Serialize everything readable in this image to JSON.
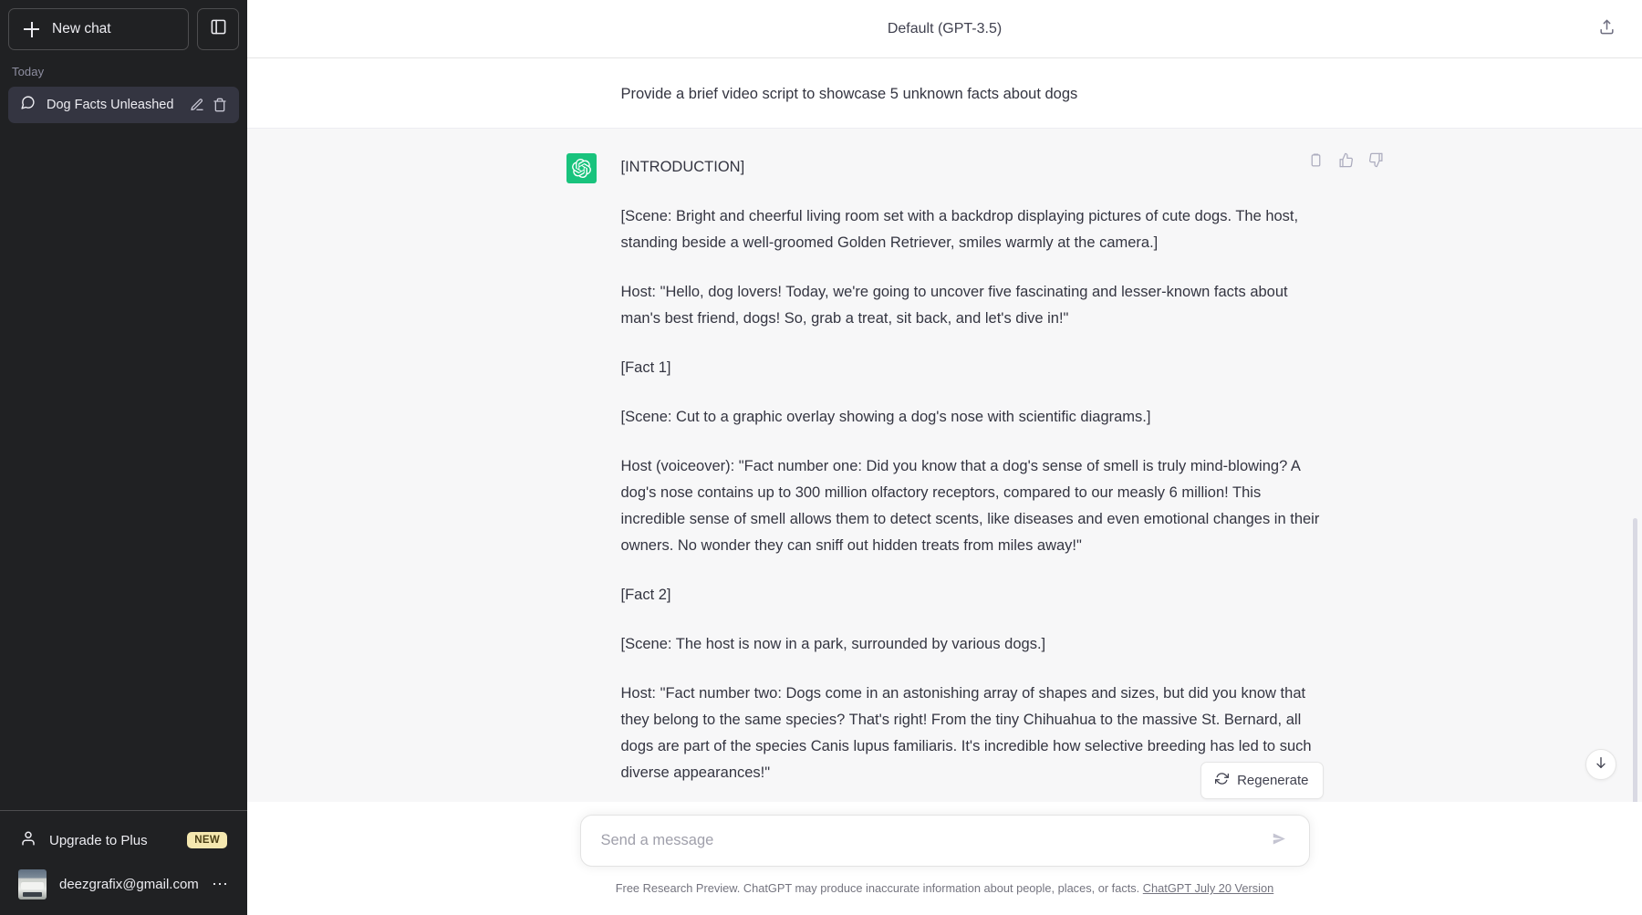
{
  "sidebar": {
    "new_chat_label": "New chat",
    "new_chat_icon": "plus-icon",
    "collapse_icon": "sidebar-toggle-icon",
    "section_label": "Today",
    "chats": [
      {
        "title": "Dog Facts Unleashed",
        "icon": "chat-bubble-icon",
        "edit_icon": "pencil-icon",
        "delete_icon": "trash-icon",
        "active": true
      }
    ],
    "upgrade": {
      "label": "Upgrade to Plus",
      "icon": "person-icon",
      "badge": "NEW",
      "badge_color": "#f5e8b0"
    },
    "account": {
      "email": "deezgrafix@gmail.com",
      "avatar": "user-avatar-truck-photo",
      "menu_icon": "ellipsis-icon"
    },
    "background_color": "#202123",
    "active_item_color": "#343541"
  },
  "topbar": {
    "title": "Default (GPT-3.5)",
    "share_icon": "share-icon"
  },
  "conversation": {
    "messages": [
      {
        "role": "user",
        "avatar": "user-avatar-truck-photo",
        "paragraphs": [
          "Provide a brief video script to showcase 5 unknown facts about dogs"
        ]
      },
      {
        "role": "assistant",
        "avatar": "openai-logo-icon",
        "avatar_color": "#19c37d",
        "paragraphs": [
          "[INTRODUCTION]",
          "[Scene: Bright and cheerful living room set with a backdrop displaying pictures of cute dogs. The host, standing beside a well-groomed Golden Retriever, smiles warmly at the camera.]",
          "Host: \"Hello, dog lovers! Today, we're going to uncover five fascinating and lesser-known facts about man's best friend, dogs! So, grab a treat, sit back, and let's dive in!\"",
          "[Fact 1]",
          "[Scene: Cut to a graphic overlay showing a dog's nose with scientific diagrams.]",
          "Host (voiceover): \"Fact number one: Did you know that a dog's sense of smell is truly mind-blowing? A dog's nose contains up to 300 million olfactory receptors, compared to our measly 6 million! This incredible sense of smell allows them to detect scents, like diseases and even emotional changes in their owners. No wonder they can sniff out hidden treats from miles away!\"",
          "[Fact 2]",
          "[Scene: The host is now in a park, surrounded by various dogs.]",
          "Host: \"Fact number two: Dogs come in an astonishing array of shapes and sizes, but did you know that they belong to the same species? That's right! From the tiny Chihuahua to the massive St. Bernard, all dogs are part of the species Canis lupus familiaris. It's incredible how selective breeding has led to such diverse appearances!\""
        ],
        "actions": {
          "copy_icon": "copy-icon",
          "thumbs_up_icon": "thumbs-up-icon",
          "thumbs_down_icon": "thumbs-down-icon"
        }
      }
    ]
  },
  "regenerate": {
    "label": "Regenerate",
    "icon": "refresh-icon"
  },
  "composer": {
    "placeholder": "Send a message",
    "value": "",
    "send_icon": "send-arrow-icon"
  },
  "footer": {
    "text": "Free Research Preview. ChatGPT may produce inaccurate information about people, places, or facts.",
    "link_text": "ChatGPT July 20 Version"
  },
  "scroll_to_bottom": {
    "icon": "arrow-down-icon"
  }
}
